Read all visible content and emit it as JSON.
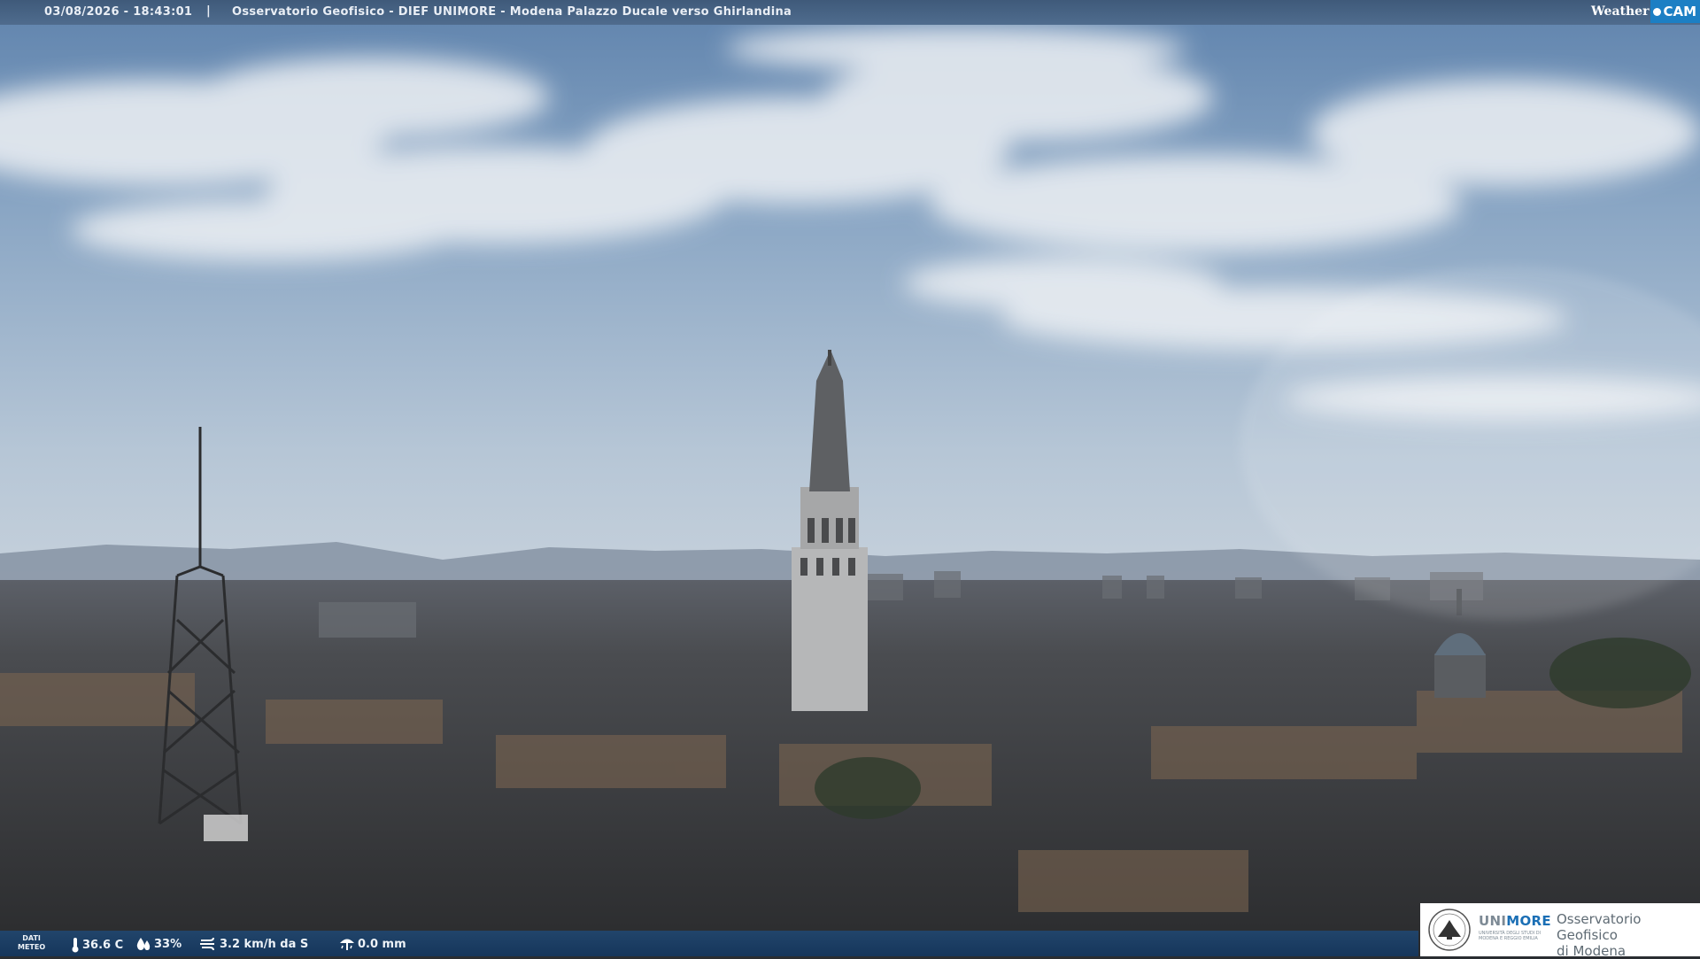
{
  "header": {
    "timestamp": "03/08/2026 - 18:43:01",
    "separator": "|",
    "title": "Osservatorio Geofisico - DIEF UNIMORE - Modena Palazzo Ducale verso Ghirlandina"
  },
  "weathercam_logo": {
    "word": "Weather",
    "cam": "CAM"
  },
  "weather_data": {
    "label_line1": "DATI",
    "label_line2": "METEO",
    "temperature": "36.6 C",
    "humidity": "33%",
    "wind": "3.2 km/h da S",
    "rain": "0.0 mm"
  },
  "institution_logo": {
    "brand_gray": "UNI",
    "brand_blue": "MORE",
    "university_line": "UNIVERSITÀ DEGLI STUDI DI MODENA E REGGIO EMILIA",
    "observatory_line1": "Osservatorio Geofisico",
    "observatory_line2": "di Modena"
  },
  "icons": {
    "temperature": "thermometer-icon",
    "humidity": "drops-icon",
    "wind": "wind-icon",
    "rain": "rain-gauge-icon"
  },
  "colors": {
    "header_bar": "#4a6788",
    "data_bar": "#1f4a78",
    "unimore_blue": "#1b6fb5",
    "weathercam_blue": "#1c7fc4"
  }
}
